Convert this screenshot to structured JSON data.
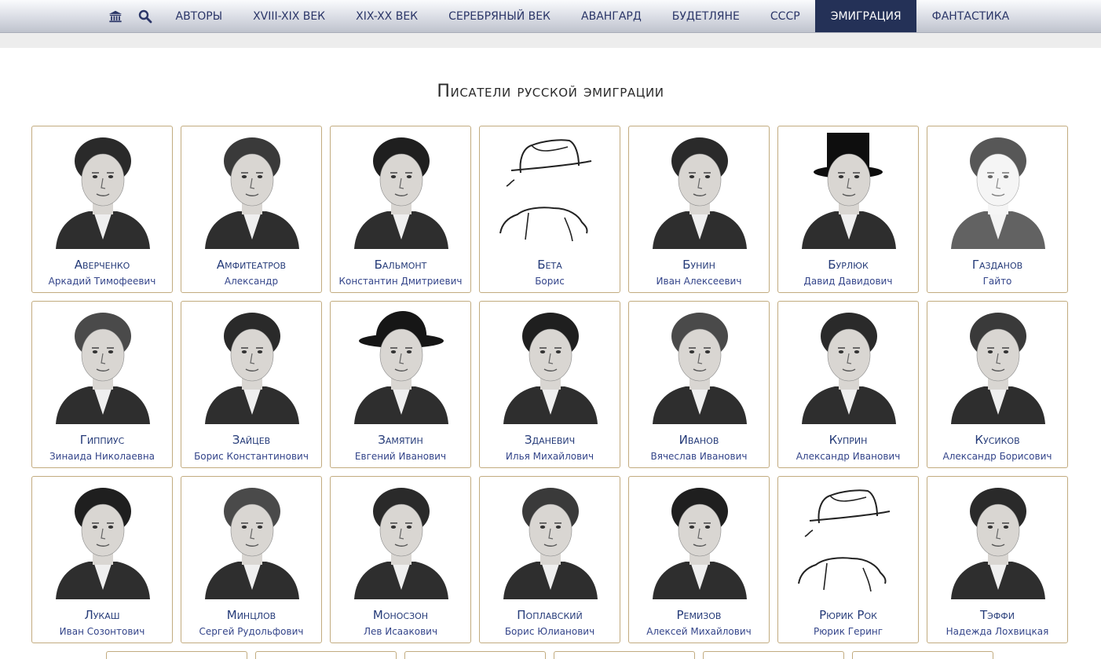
{
  "nav": {
    "home_icon": "museum-icon",
    "search_icon": "search-icon",
    "items": [
      {
        "label": "АВТОРЫ",
        "active": false
      },
      {
        "label": "XVIII-XIX ВЕК",
        "active": false
      },
      {
        "label": "XIX-XX ВЕК",
        "active": false
      },
      {
        "label": "СЕРЕБРЯНЫЙ ВЕК",
        "active": false
      },
      {
        "label": "АВАНГАРД",
        "active": false
      },
      {
        "label": "БУДЕТЛЯНЕ",
        "active": false
      },
      {
        "label": "СССР",
        "active": false
      },
      {
        "label": "ЭМИГРАЦИЯ",
        "active": true
      },
      {
        "label": "ФАНТАСТИКА",
        "active": false
      }
    ],
    "active_color": "#243157"
  },
  "page": {
    "title": "Писатели русской эмиграции"
  },
  "writers": [
    {
      "surname": "Аверченко",
      "firstname": "Аркадий Тимофеевич",
      "portrait": "photo"
    },
    {
      "surname": "Амфитеатров",
      "firstname": "Александр",
      "portrait": "photo"
    },
    {
      "surname": "Бальмонт",
      "firstname": "Константин Дмитриевич",
      "portrait": "photo"
    },
    {
      "surname": "Бета",
      "firstname": "Борис",
      "portrait": "hat-placeholder"
    },
    {
      "surname": "Бунин",
      "firstname": "Иван Алексеевич",
      "portrait": "photo"
    },
    {
      "surname": "Бурлюк",
      "firstname": "Давид Давидович",
      "portrait": "photo-tophat"
    },
    {
      "surname": "Газданов",
      "firstname": "Гайто",
      "portrait": "drawing"
    },
    {
      "surname": "Гиппиус",
      "firstname": "Зинаида Николаевна",
      "portrait": "photo"
    },
    {
      "surname": "Зайцев",
      "firstname": "Борис Константинович",
      "portrait": "photo"
    },
    {
      "surname": "Замятин",
      "firstname": "Евгений Иванович",
      "portrait": "photo-hat"
    },
    {
      "surname": "Зданевич",
      "firstname": "Илья Михайлович",
      "portrait": "photo"
    },
    {
      "surname": "Иванов",
      "firstname": "Вячеслав Иванович",
      "portrait": "photo"
    },
    {
      "surname": "Куприн",
      "firstname": "Александр Иванович",
      "portrait": "photo"
    },
    {
      "surname": "Кусиков",
      "firstname": "Александр Борисович",
      "portrait": "photo"
    },
    {
      "surname": "Лукаш",
      "firstname": "Иван Созонтович",
      "portrait": "photo"
    },
    {
      "surname": "Минцлов",
      "firstname": "Сергей Рудольфович",
      "portrait": "photo"
    },
    {
      "surname": "Моносзон",
      "firstname": "Лев Исаакович",
      "portrait": "photo"
    },
    {
      "surname": "Поплавский",
      "firstname": "Борис Юлианович",
      "portrait": "photo"
    },
    {
      "surname": "Ремизов",
      "firstname": "Алексей Михайлович",
      "portrait": "photo"
    },
    {
      "surname": "Рюрик Рок",
      "firstname": "Рюрик Геринг",
      "portrait": "hat-placeholder"
    },
    {
      "surname": "Тэффи",
      "firstname": "Надежда Лохвицкая",
      "portrait": "photo"
    }
  ],
  "colors": {
    "card_border": "#c2ab7f",
    "link": "#243a78"
  }
}
